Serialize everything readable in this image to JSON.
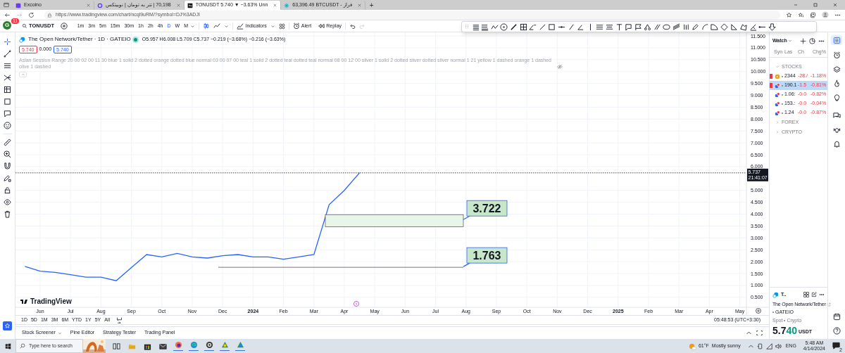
{
  "browser": {
    "tabs": [
      {
        "title": "Excoino",
        "selected": false
      },
      {
        "title": "70,198 | تتر به تومان | نوبیتکس",
        "selected": false
      },
      {
        "title": "TONUSDT 5.740 ▼ −3.63% Unn",
        "selected": true
      },
      {
        "title": "63,396.49 BTCUSDT - فراز",
        "selected": false
      }
    ],
    "new_tab": "+",
    "url": "https://www.tradingview.com/chart/ncql9uRM/?symbol=DJ%3ADJI"
  },
  "header": {
    "avatar": "G",
    "notifications": "11",
    "symbol": "TONUSDT",
    "intervals": [
      {
        "label": "1m",
        "selected": false
      },
      {
        "label": "3m",
        "selected": false
      },
      {
        "label": "5m",
        "selected": false
      },
      {
        "label": "15m",
        "selected": false
      },
      {
        "label": "30m",
        "selected": false
      },
      {
        "label": "1h",
        "selected": false
      },
      {
        "label": "2h",
        "selected": false
      },
      {
        "label": "4h",
        "selected": false
      },
      {
        "label": "D",
        "selected": true
      },
      {
        "label": "W",
        "selected": false
      },
      {
        "label": "M",
        "selected": false
      }
    ],
    "indicators": "Indicators",
    "alert": "Alert",
    "replay": "Replay"
  },
  "legend": {
    "title": "The Open Network/Tether · 1D · GATEIO",
    "ohlc": "O5.957 H6.008 L5.709 C5.737 −0.219 (−3.68%) −0.216 (−3.63%)",
    "sell": "5.740",
    "spread": "0.000",
    "buy": "5.740",
    "indicator": "Asian Session Range 20 00 02 00 11 30 blue 1 solid 2 dotted orange dotted blue normal 03 00 07 00 teal 1 solid 2 dotted teal dotted teal normal 08 00 12 00 silver 1 solid 2 dotted silver dotted silver normal 1 21 yellow 1 dashed orange 1 dashed olive 1 dashed"
  },
  "chart": {
    "chart_data": {
      "type": "line",
      "ylim": [
        0.08,
        11.65
      ],
      "categories": [
        null,
        "Jun",
        null,
        "Jul",
        null,
        "Aug",
        null,
        "Sep",
        null,
        "Oct",
        null,
        "Nov",
        null,
        "Dec",
        null,
        "2024",
        null,
        "Feb",
        null,
        "Mar",
        null,
        "Apr",
        null,
        "May",
        null,
        "Jun",
        null,
        "Jul",
        null,
        "Aug",
        null,
        "Sep",
        null,
        "Oct",
        null,
        "Nov",
        null,
        "Dec",
        null,
        "2025",
        null,
        "Feb",
        null,
        "Mar",
        null,
        "Apr",
        null,
        "May"
      ],
      "series": [
        {
          "color": "#2962ff",
          "values": [
            1.8,
            1.6,
            1.55,
            1.45,
            1.35,
            1.35,
            1.2,
            1.75,
            2.3,
            2.2,
            2.35,
            2.2,
            2.15,
            2.25,
            2.3,
            2.2,
            2.2,
            2.1,
            2.2,
            2.3,
            4.4,
            5.0,
            5.74,
            null,
            null,
            null,
            null,
            null,
            null,
            null,
            null,
            null,
            null,
            null,
            null,
            null,
            null,
            null,
            null,
            null,
            null,
            null,
            null,
            null,
            null,
            null,
            null,
            null
          ]
        }
      ],
      "yticks": [
        {
          "value": 11.5,
          "label": "11.500"
        },
        {
          "value": 11,
          "label": "11.000"
        },
        {
          "value": 10.5,
          "label": "10.500"
        },
        {
          "value": 10,
          "label": "10.000"
        },
        {
          "value": 9.5,
          "label": "9.500"
        },
        {
          "value": 9,
          "label": "9.000"
        },
        {
          "value": 8.5,
          "label": "8.500"
        },
        {
          "value": 8,
          "label": "8.000"
        },
        {
          "value": 7.5,
          "label": "7.500"
        },
        {
          "value": 7,
          "label": "7.000"
        },
        {
          "value": 6.5,
          "label": "6.500"
        },
        {
          "value": 6,
          "label": "6.000"
        },
        {
          "value": 5,
          "label": "5.000"
        },
        {
          "value": 4.5,
          "label": "4.500"
        },
        {
          "value": 4,
          "label": "4.000"
        },
        {
          "value": 3.5,
          "label": "3.500"
        },
        {
          "value": 3,
          "label": "3.000"
        },
        {
          "value": 2.5,
          "label": "2.500"
        },
        {
          "value": 2,
          "label": "2.000"
        },
        {
          "value": 1.5,
          "label": "1.500"
        },
        {
          "value": 1,
          "label": "1.000"
        },
        {
          "value": 0.5,
          "label": "0.500"
        }
      ],
      "grid": true,
      "bands": [
        {
          "axis": "y",
          "from": 3.47,
          "to": 3.98,
          "label": "3.722"
        }
      ],
      "ref_lines": [
        {
          "axis": "y",
          "value": 1.763,
          "label": "1.763"
        },
        {
          "axis": "y",
          "value": 5.737
        }
      ]
    },
    "price_tag": "5.737",
    "countdown": "21:41:07",
    "logo": "TradingView"
  },
  "range_bar": {
    "ranges": [
      "1D",
      "5D",
      "1M",
      "3M",
      "6M",
      "YTD",
      "1Y",
      "5Y",
      "All"
    ],
    "time": "05:48:53 (UTC+3:30)"
  },
  "bottom_tabs": [
    {
      "label": "Stock Screener",
      "dropdown": true
    },
    {
      "label": "Pine Editor",
      "dropdown": false
    },
    {
      "label": "Strategy Tester",
      "dropdown": false
    },
    {
      "label": "Trading Panel",
      "dropdown": false
    }
  ],
  "watchlist": {
    "title": "Watch",
    "columns": [
      "Syn",
      "Las",
      "Ch",
      "Chg%"
    ],
    "groups": [
      {
        "name": "STOCKS",
        "expanded": true,
        "rows": [
          {
            "last": "2344",
            "change": "-28./",
            "change_pct": "-1.18%",
            "flagged": true,
            "selected": false
          },
          {
            "last": "190.1",
            "change": "-1.5",
            "change_pct": "-0.81%",
            "flagged": true,
            "selected": true
          },
          {
            "last": "1.06:",
            "change": "-0.0",
            "change_pct": "-0.82%",
            "flagged": false,
            "selected": false
          },
          {
            "last": "153.:",
            "change": "-0.0",
            "change_pct": "-0.04%",
            "flagged": false,
            "selected": false
          },
          {
            "last": "1.24",
            "change": "-0.0",
            "change_pct": "-0.87%",
            "flagged": false,
            "selected": false
          }
        ]
      },
      {
        "name": "FOREX",
        "expanded": false
      },
      {
        "name": "CRYPTO",
        "expanded": false
      }
    ],
    "details": {
      "short_name": "T..",
      "name": "The Open Network/Tether",
      "exchange": "GATEIO",
      "market": "Spot",
      "category": "Crypto",
      "price": "5.7",
      "price_tail": "40",
      "currency": "USDT"
    }
  },
  "taskbar": {
    "search_placeholder": "Type here to search",
    "temperature": "61°F",
    "weather": "Mostly sunny",
    "language": "ENG",
    "time": "5:48 AM",
    "date": "4/14/2024",
    "notifications": "2"
  }
}
